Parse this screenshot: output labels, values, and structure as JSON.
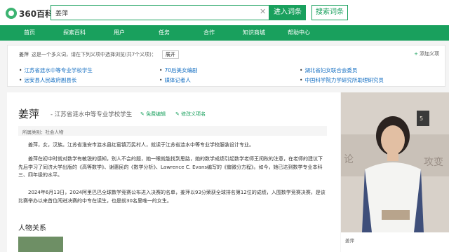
{
  "header": {
    "logo_text": "360百科",
    "search_value": "姜萍",
    "enter_label": "进入词条",
    "search_label": "搜索词条"
  },
  "nav": [
    "首页",
    "探索百科",
    "用户",
    "任务",
    "合作",
    "知识商城",
    "帮助中心"
  ],
  "ambiguity": {
    "term": "姜萍",
    "note": "这是一个多义词，请在下列义项中选择浏览(共7个义项)：",
    "expand": "展开",
    "add": "添加义项",
    "senses": [
      "江苏省涟水中等专业学校学生",
      "70后美女编剧",
      "湖北省妇女联合会委员",
      "远安县人民政府副县长",
      "媒体记者人",
      "中国科学院力学研究所助理研究员"
    ]
  },
  "entry": {
    "title": "姜萍",
    "subtitle": "- 江苏省涟水中等专业学校学生",
    "edit": "免费编辑",
    "modify": "修改义项名",
    "category": "所属类别：社会人物",
    "paragraphs": [
      "姜萍，女，汉族。江苏省淮安市涟水县红窑镇万民村人，就读于江苏省涟水中等专业学校服装设计专业。",
      "姜萍在初中时就对数学有敏锐的感知，别人不会的题，她一眼就能找到思路，她的数学成绩引起数学老师王闰秋的注意，在老师的建议下先后学习了同济大学出版的《高等数学》、谢惠民的《数学分析》、Lawrence C. Evans编写的《偏微分方程》。如今，她已达到数学专业本科三、四年级的水平。",
      "2024年6月13日，2024阿里巴巴全球数学竞赛公布进入决赛的名单，姜萍以93分荣获全球排名第12位的成绩，入围数学竞赛决赛，是该比赛举办以来首位闯进决赛的中专在读生，也是前30名里唯一的女生。"
    ],
    "section": "人物关系"
  },
  "side": {
    "caption": "姜萍"
  }
}
